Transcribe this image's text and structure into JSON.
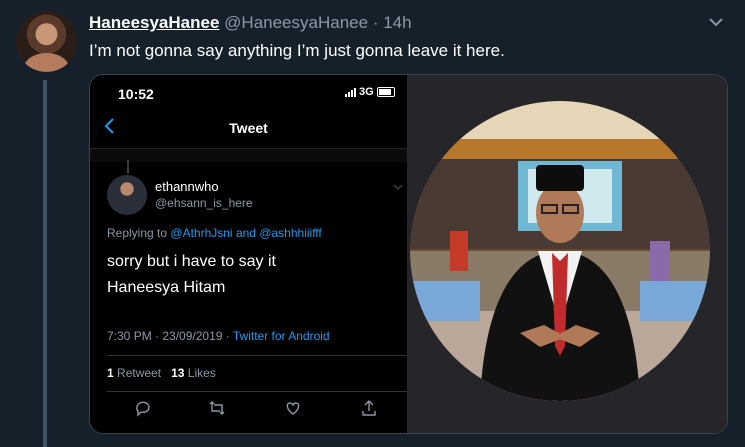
{
  "tweet": {
    "display_name": "HaneesyaHanee",
    "handle": "@HaneesyaHanee",
    "separator": "·",
    "time": "14h",
    "text": "I’m not gonna say anything I’m just gonna leave it here."
  },
  "screenshot": {
    "status": {
      "time": "10:52",
      "network": "3G"
    },
    "nav": {
      "title": "Tweet"
    },
    "reply": {
      "name": "ethannwho",
      "handle": "@ehsann_is_here",
      "replying_prefix": "Replying to",
      "mention_1": "@AthrhJsni",
      "and": "and",
      "mention_2": "@ashhhiiifff",
      "line_1": "sorry but i have to say it",
      "line_2": "Haneesya Hitam",
      "meta_time": "7:30 PM · 23/09/2019 ·",
      "source": "Twitter for Android",
      "retweet_count": "1",
      "retweet_label": "Retweet",
      "like_count": "13",
      "like_label": "Likes"
    }
  },
  "colors": {
    "background": "#15202b",
    "link": "#1d9bf0",
    "muted": "#8899a6",
    "border": "#38444d"
  }
}
